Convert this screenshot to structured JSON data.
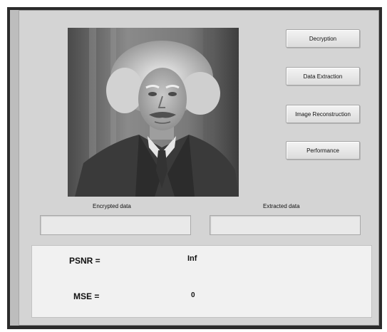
{
  "buttons": {
    "decryption": "Decryption",
    "data_extraction": "Data Extraction",
    "image_reconstruction": "Image Reconstruction",
    "performance": "Performance"
  },
  "labels": {
    "encrypted_data": "Encrypted data",
    "extracted_data": "Extracted data"
  },
  "fields": {
    "encrypted_data_value": "",
    "extracted_data_value": ""
  },
  "metrics": {
    "psnr_label": "PSNR =",
    "psnr_value": "Inf",
    "mse_label": "MSE =",
    "mse_value": "0"
  },
  "image": {
    "icon": "portrait-photo",
    "mode": "grayscale"
  }
}
